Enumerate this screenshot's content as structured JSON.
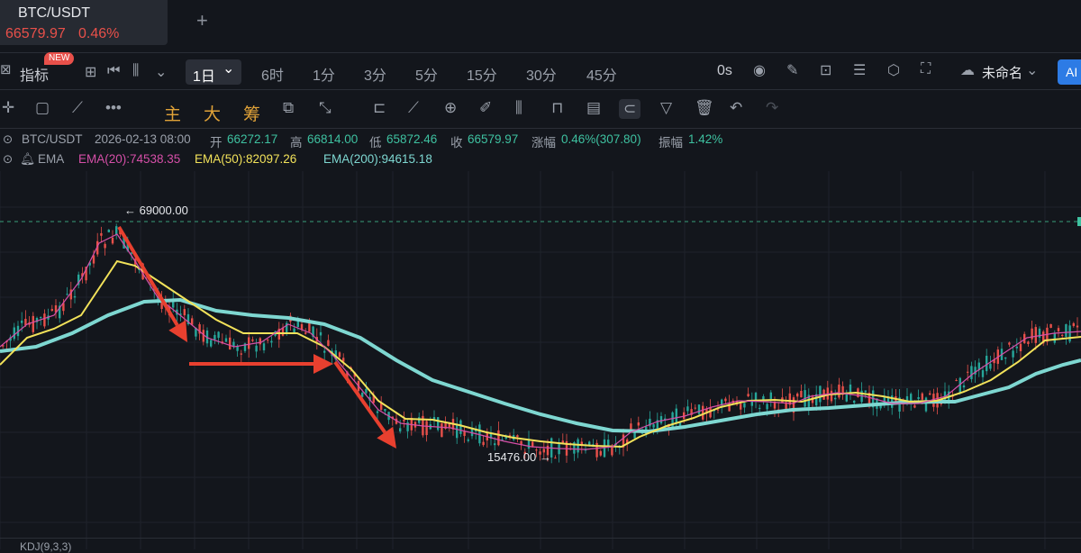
{
  "tab": {
    "symbol": "BTC/USDT",
    "price": "66579.97",
    "change_pct": "0.46%",
    "new_tab_icon": "+"
  },
  "toolbar": {
    "indicators_label": "指标",
    "new_badge": "NEW",
    "active_interval": "1日",
    "intervals": [
      "6时",
      "1分",
      "3分",
      "5分",
      "15分",
      "30分",
      "45分"
    ],
    "countdown": "0s",
    "layout_name": "未命名",
    "ai_label": "AI"
  },
  "toolbar2": {
    "main_label": "主",
    "big_label": "大",
    "chips_label": "筹"
  },
  "ohlc": {
    "symbol": "BTC/USDT",
    "datetime": "2026-02-13 08:00",
    "open_label": "开",
    "open": "66272.17",
    "high_label": "高",
    "high": "66814.00",
    "low_label": "低",
    "low": "65872.46",
    "close_label": "收",
    "close": "66579.97",
    "change_label": "涨幅",
    "change": "0.46%(307.80)",
    "amplitude_label": "振幅",
    "amplitude": "1.42%"
  },
  "ema": {
    "label": "EMA",
    "ema20": "EMA(20):74538.35",
    "ema50": "EMA(50):82097.26",
    "ema200": "EMA(200):94615.18"
  },
  "annotations": {
    "high_marker": "← 69000.00",
    "low_marker": "15476.00 →"
  },
  "colors": {
    "up": "#26a69a",
    "down": "#e8504a",
    "ema20": "#d64fa8",
    "ema50": "#f2e25a",
    "ema200": "#7ed7d1",
    "arrow": "#e8402f",
    "accent": "#2d7be5"
  },
  "chart_data": {
    "type": "line",
    "title": "BTC/USDT 1日",
    "series": [
      {
        "name": "EMA(20)",
        "values": []
      },
      {
        "name": "EMA(50)",
        "values": []
      },
      {
        "name": "EMA(200)",
        "values": []
      }
    ],
    "annotated_high": 69000.0,
    "annotated_low": 15476.0,
    "grid": true
  },
  "bottom_indicator": "KDJ(9,3,3)"
}
